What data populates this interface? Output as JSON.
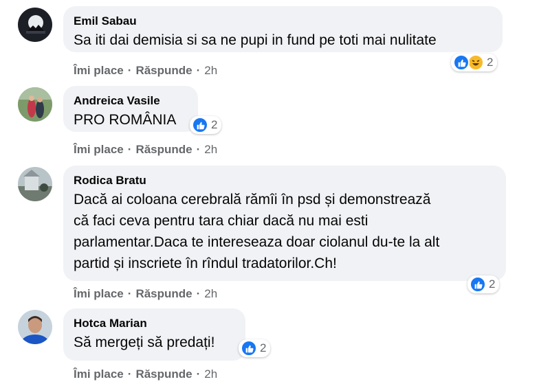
{
  "comments": [
    {
      "author": "Emil Sabau",
      "text": "Sa iti dai demisia si sa ne pupi in fund pe toti mai nulitate",
      "reaction_count": "2",
      "reaction_icons": [
        "like-icon",
        "haha-icon"
      ],
      "like_label": "Îmi place",
      "reply_label": "Răspunde",
      "time": "2h"
    },
    {
      "author": "Andreica Vasile",
      "text": "PRO ROMÂNIA",
      "reaction_count": "2",
      "reaction_icons": [
        "like-icon"
      ],
      "like_label": "Îmi place",
      "reply_label": "Răspunde",
      "time": "2h"
    },
    {
      "author": "Rodica Bratu",
      "text_lines": [
        "Dacă ai coloana cerebrală rămîi în psd și demonstrează",
        "că faci ceva pentru tara chiar dacă nu mai esti",
        "parlamentar.Daca te intereseaza doar ciolanul du-te la alt",
        "partid și inscriete în rîndul tradatorilor.Ch!"
      ],
      "reaction_count": "2",
      "reaction_icons": [
        "like-icon"
      ],
      "like_label": "Îmi place",
      "reply_label": "Răspunde",
      "time": "2h"
    },
    {
      "author": "Hotca Marian",
      "text": "Să mergeți să predați!",
      "reaction_count": "2",
      "reaction_icons": [
        "like-icon"
      ],
      "like_label": "Îmi place",
      "reply_label": "Răspunde",
      "time": "2h"
    }
  ],
  "colors": {
    "bubble": "#f0f2f5",
    "like_blue": "#1877f2",
    "haha_yellow": "#f7b928",
    "meta_gray": "#65676b"
  }
}
